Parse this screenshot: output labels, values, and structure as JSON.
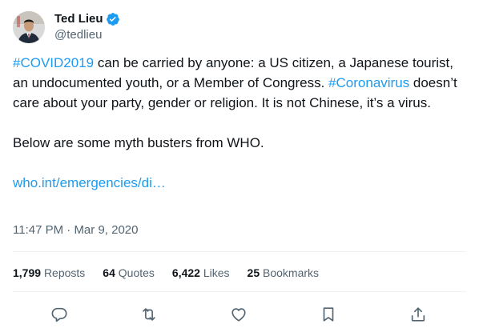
{
  "author": {
    "display_name": "Ted Lieu",
    "handle": "@tedlieu",
    "verified": true
  },
  "tweet": {
    "segments": [
      {
        "type": "hashtag",
        "text": "#COVID2019"
      },
      {
        "type": "text",
        "text": " can be carried by anyone: a US citizen, a Japanese tourist, an undocumented youth, or a Member of Congress. "
      },
      {
        "type": "hashtag",
        "text": "#Coronavirus"
      },
      {
        "type": "text",
        "text": " doesn’t care about your party, gender or religion. It is not Chinese, it’s a virus.\n\nBelow are some myth busters from WHO.\n\n"
      },
      {
        "type": "link",
        "text": "who.int/emergencies/di…"
      }
    ]
  },
  "timestamp": {
    "time": "11:47 PM",
    "separator": " · ",
    "date": "Mar 9, 2020"
  },
  "stats": {
    "reposts": {
      "count": "1,799",
      "label": "Reposts"
    },
    "quotes": {
      "count": "64",
      "label": "Quotes"
    },
    "likes": {
      "count": "6,422",
      "label": "Likes"
    },
    "bookmarks": {
      "count": "25",
      "label": "Bookmarks"
    }
  },
  "icons": {
    "reply": "reply-icon",
    "repost": "repost-icon",
    "like": "heart-icon",
    "bookmark": "bookmark-icon",
    "share": "share-icon",
    "verified": "verified-badge-icon"
  },
  "colors": {
    "accent": "#1d9bf0",
    "text": "#0f1419",
    "secondary": "#536471",
    "divider": "#eff3f4"
  }
}
